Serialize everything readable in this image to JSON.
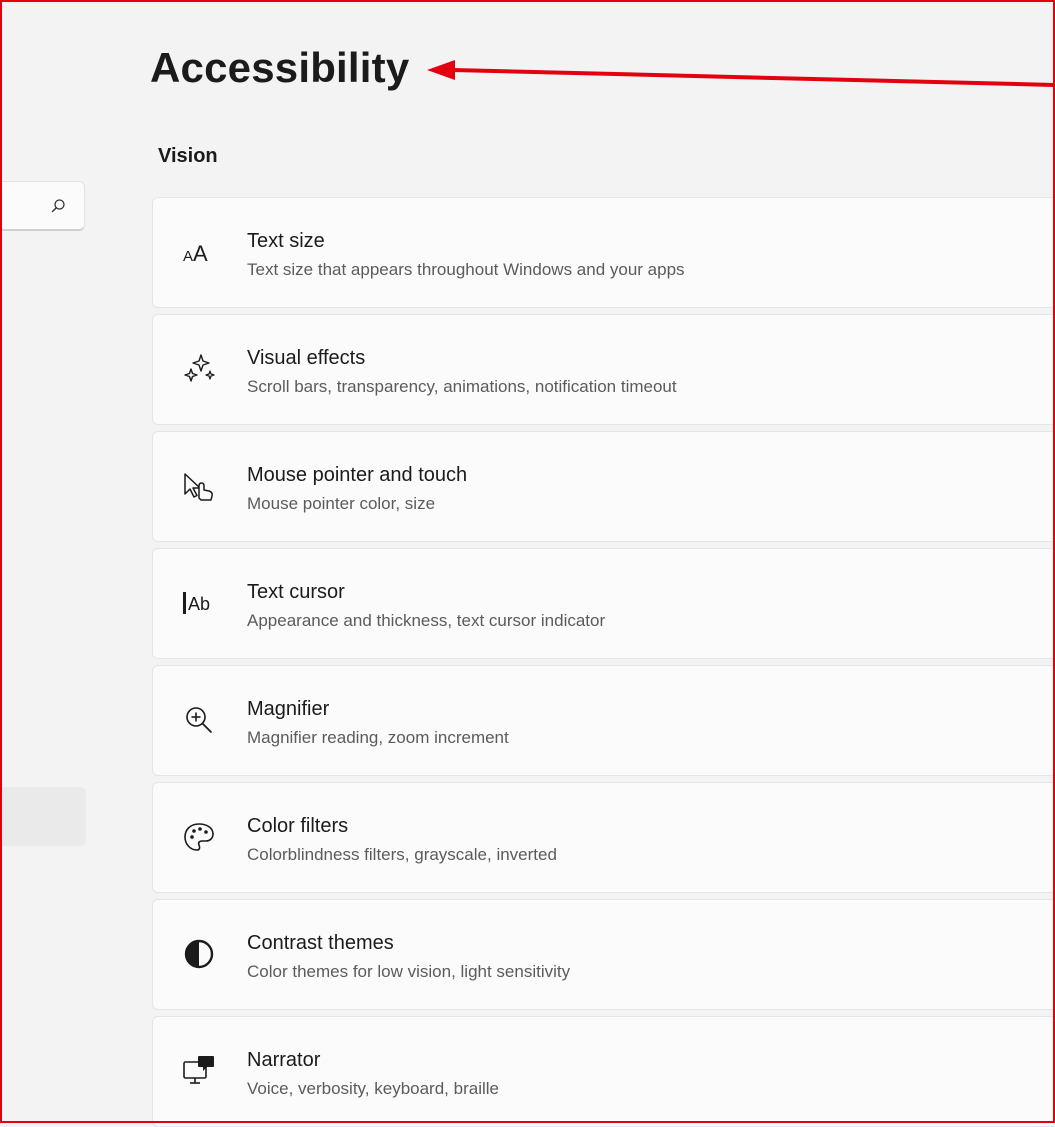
{
  "page": {
    "title": "Accessibility"
  },
  "section": {
    "label": "Vision"
  },
  "accent": {
    "annotation_red": "#e3000f"
  },
  "settings": [
    {
      "title": "Text size",
      "subtitle": "Text size that appears throughout Windows and your apps",
      "icon": "text-size-icon"
    },
    {
      "title": "Visual effects",
      "subtitle": "Scroll bars, transparency, animations, notification timeout",
      "icon": "sparkle-icon"
    },
    {
      "title": "Mouse pointer and touch",
      "subtitle": "Mouse pointer color, size",
      "icon": "mouse-pointer-touch-icon"
    },
    {
      "title": "Text cursor",
      "subtitle": "Appearance and thickness, text cursor indicator",
      "icon": "text-cursor-icon"
    },
    {
      "title": "Magnifier",
      "subtitle": "Magnifier reading, zoom increment",
      "icon": "magnifier-icon"
    },
    {
      "title": "Color filters",
      "subtitle": "Colorblindness filters, grayscale, inverted",
      "icon": "palette-icon"
    },
    {
      "title": "Contrast themes",
      "subtitle": "Color themes for low vision, light sensitivity",
      "icon": "contrast-icon"
    },
    {
      "title": "Narrator",
      "subtitle": "Voice, verbosity, keyboard, braille",
      "icon": "narrator-icon"
    }
  ]
}
